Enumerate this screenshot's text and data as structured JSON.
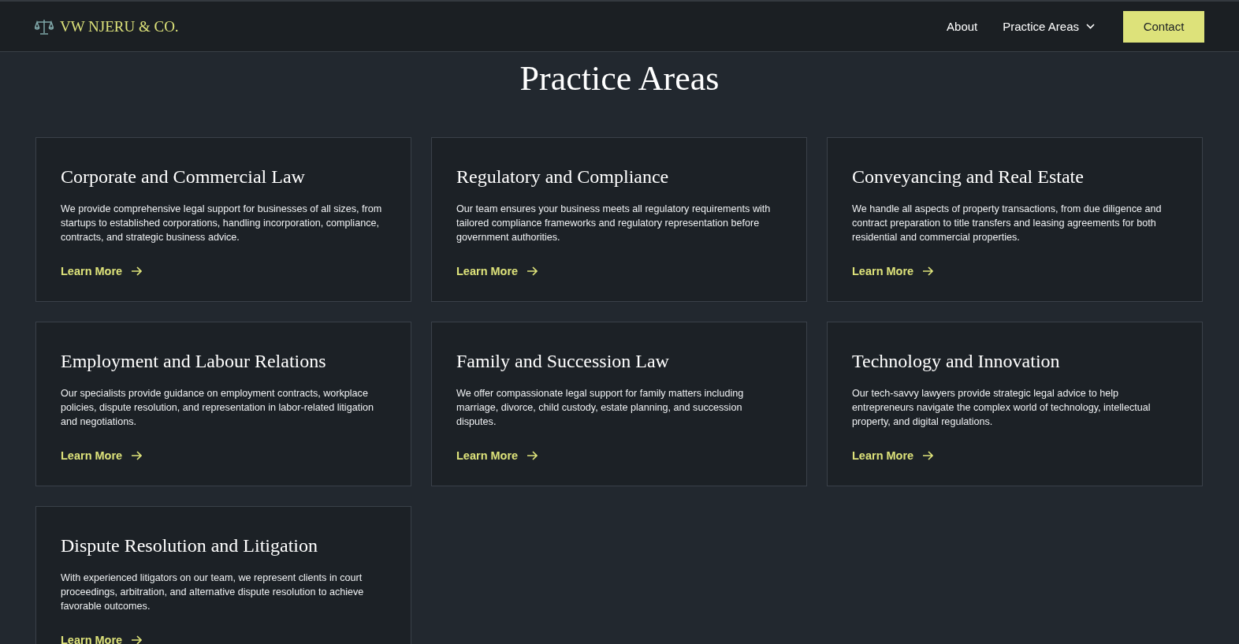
{
  "brand": {
    "name": "VW NJERU & CO."
  },
  "nav": {
    "links": [
      {
        "label": "About",
        "kind": "link"
      },
      {
        "label": "Practice Areas",
        "kind": "dropdown"
      }
    ],
    "cta": "Contact"
  },
  "page_title": "Practice Areas",
  "cards": [
    {
      "title": "Corporate and Commercial Law",
      "text": "We provide comprehensive legal support for businesses of all sizes, from startups to established corporations, handling incorporation, compliance, contracts, and strategic business advice.",
      "link": "Learn More"
    },
    {
      "title": "Regulatory and Compliance",
      "text": "Our team ensures your business meets all regulatory requirements with tailored compliance frameworks and regulatory representation before government authorities.",
      "link": "Learn More"
    },
    {
      "title": "Conveyancing and Real Estate",
      "text": "We handle all aspects of property transactions, from due diligence and contract preparation to title transfers and leasing agreements for both residential and commercial properties.",
      "link": "Learn More"
    },
    {
      "title": "Employment and Labour Relations",
      "text": "Our specialists provide guidance on employment contracts, workplace policies, dispute resolution, and representation in labor-related litigation and negotiations.",
      "link": "Learn More"
    },
    {
      "title": "Family and Succession Law",
      "text": "We offer compassionate legal support for family matters including marriage, divorce, child custody, estate planning, and succession disputes.",
      "link": "Learn More"
    },
    {
      "title": "Technology and Innovation",
      "text": "Our tech-savvy lawyers provide strategic legal advice to help entrepreneurs navigate the complex world of technology, intellectual property, and digital regulations.",
      "link": "Learn More"
    },
    {
      "title": "Dispute Resolution and Litigation",
      "text": "With experienced litigators on our team, we represent clients in court proceedings, arbitration, and alternative dispute resolution to achieve favorable outcomes.",
      "link": "Learn More"
    }
  ]
}
